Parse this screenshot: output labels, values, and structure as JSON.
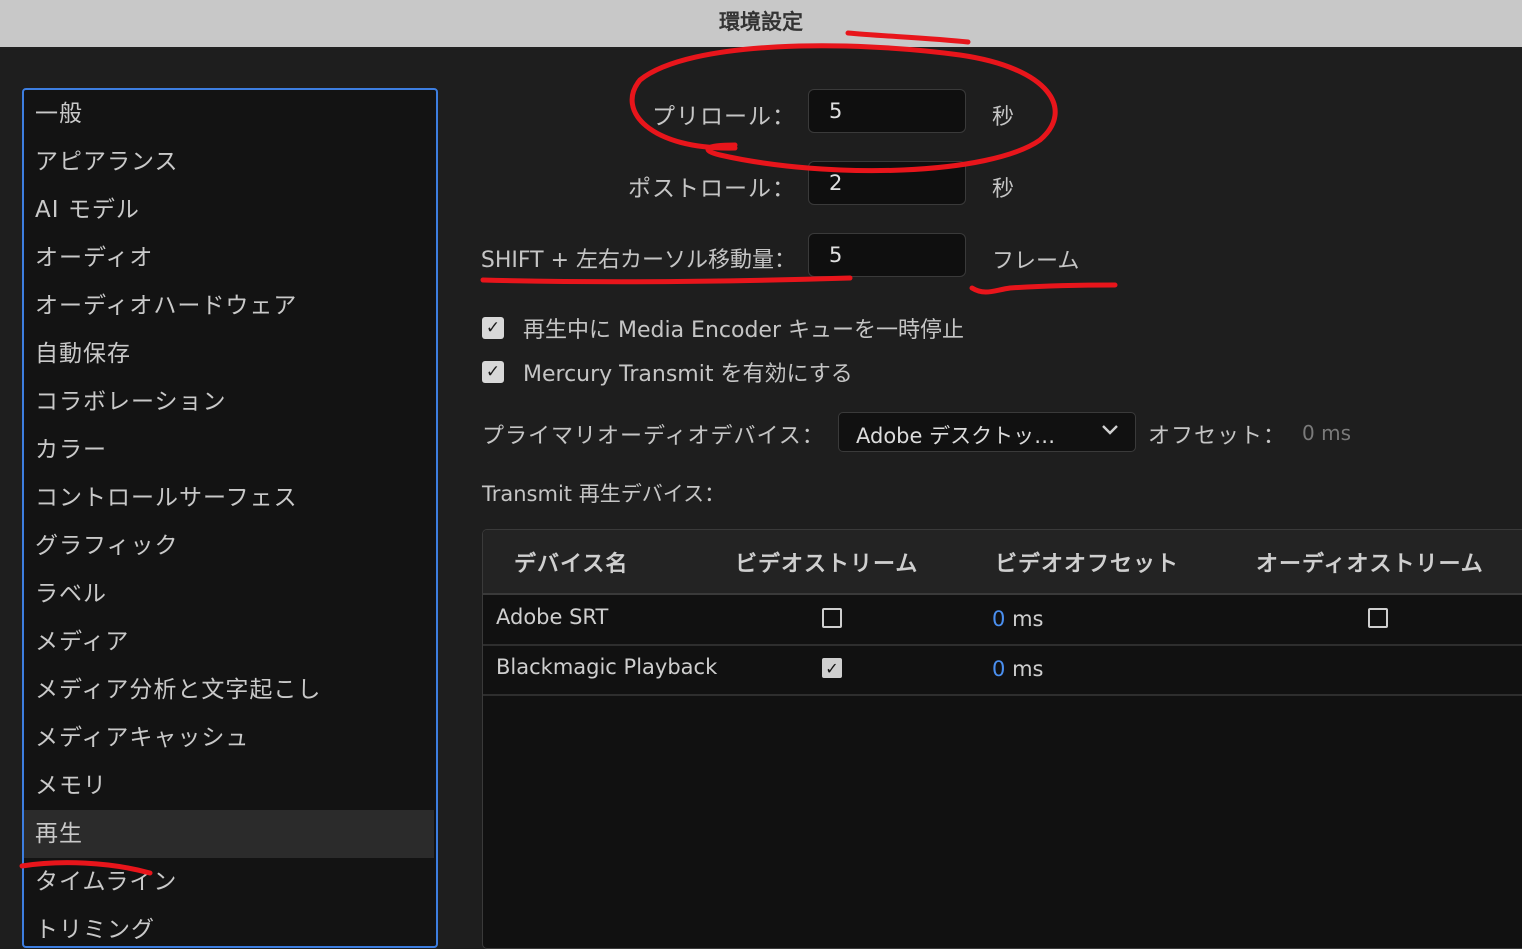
{
  "window": {
    "title": "環境設定"
  },
  "sidebar": {
    "items": [
      {
        "label": "一般"
      },
      {
        "label": "アピアランス"
      },
      {
        "label": "AI モデル"
      },
      {
        "label": "オーディオ"
      },
      {
        "label": "オーディオハードウェア"
      },
      {
        "label": "自動保存"
      },
      {
        "label": "コラボレーション"
      },
      {
        "label": "カラー"
      },
      {
        "label": "コントロールサーフェス"
      },
      {
        "label": "グラフィック"
      },
      {
        "label": "ラベル"
      },
      {
        "label": "メディア"
      },
      {
        "label": "メディア分析と文字起こし"
      },
      {
        "label": "メディアキャッシュ"
      },
      {
        "label": "メモリ"
      },
      {
        "label": "再生"
      },
      {
        "label": "タイムライン"
      },
      {
        "label": "トリミング"
      }
    ],
    "active": "再生"
  },
  "playback": {
    "preroll": {
      "label": "プリロール：",
      "value": "5",
      "unit": "秒"
    },
    "postroll": {
      "label": "ポストロール：",
      "value": "2",
      "unit": "秒"
    },
    "shift_move": {
      "label": "SHIFT + 左右カーソル移動量：",
      "value": "5",
      "unit": "フレーム"
    },
    "pause_encoder": {
      "label": "再生中に Media Encoder キューを一時停止",
      "checked": true
    },
    "mercury": {
      "label": "Mercury Transmit を有効にする",
      "checked": true
    },
    "audio_device": {
      "label": "プライマリオーディオデバイス：",
      "value": "Adobe デスクトッ…"
    },
    "offset": {
      "label": "オフセット：",
      "value": "0 ms"
    },
    "transmit_label": "Transmit 再生デバイス："
  },
  "devices_table": {
    "headers": [
      "デバイス名",
      "ビデオストリーム",
      "ビデオオフセット",
      "オーディオストリーム"
    ],
    "rows": [
      {
        "name": "Adobe SRT",
        "video_stream": false,
        "offset_value": "0",
        "offset_unit": "ms",
        "audio_stream": false
      },
      {
        "name": "Blackmagic Playback",
        "video_stream": true,
        "offset_value": "0",
        "offset_unit": "ms"
      }
    ]
  },
  "colors": {
    "annotation": "#e8151b",
    "accent": "#3d7ee0"
  }
}
